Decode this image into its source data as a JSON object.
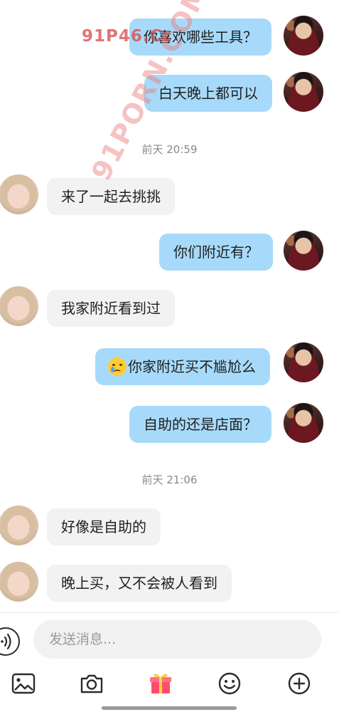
{
  "messages": [
    {
      "side": "right",
      "text": "你喜欢哪些工具？"
    },
    {
      "side": "right",
      "text": "白天晚上都可以"
    },
    {
      "side": "time",
      "text": "前天 20:59"
    },
    {
      "side": "left",
      "text": "来了一起去挑挑"
    },
    {
      "side": "right",
      "text": "你们附近有？"
    },
    {
      "side": "left",
      "text": "我家附近看到过"
    },
    {
      "side": "right",
      "emoji": "crying-face",
      "text": "你家附近买不尴尬么"
    },
    {
      "side": "right",
      "text": "自助的还是店面？"
    },
    {
      "side": "time",
      "text": "前天 21:06"
    },
    {
      "side": "left",
      "text": "好像是自助的"
    },
    {
      "side": "left",
      "text": "晚上买，又不会被人看到"
    }
  ],
  "composer": {
    "placeholder": "发送消息...",
    "voice_icon": "voice-icon"
  },
  "toolbar": {
    "icons": [
      "image-icon",
      "camera-icon",
      "gift-icon",
      "emoji-icon",
      "add-icon"
    ]
  },
  "watermarks": {
    "top": "91P46.Cc",
    "diagonal": "91PORN.COM"
  },
  "colors": {
    "outgoing_bubble": "#a7dafa",
    "incoming_bubble": "#f2f2f2",
    "gift_accent": "#ff4d6d"
  }
}
